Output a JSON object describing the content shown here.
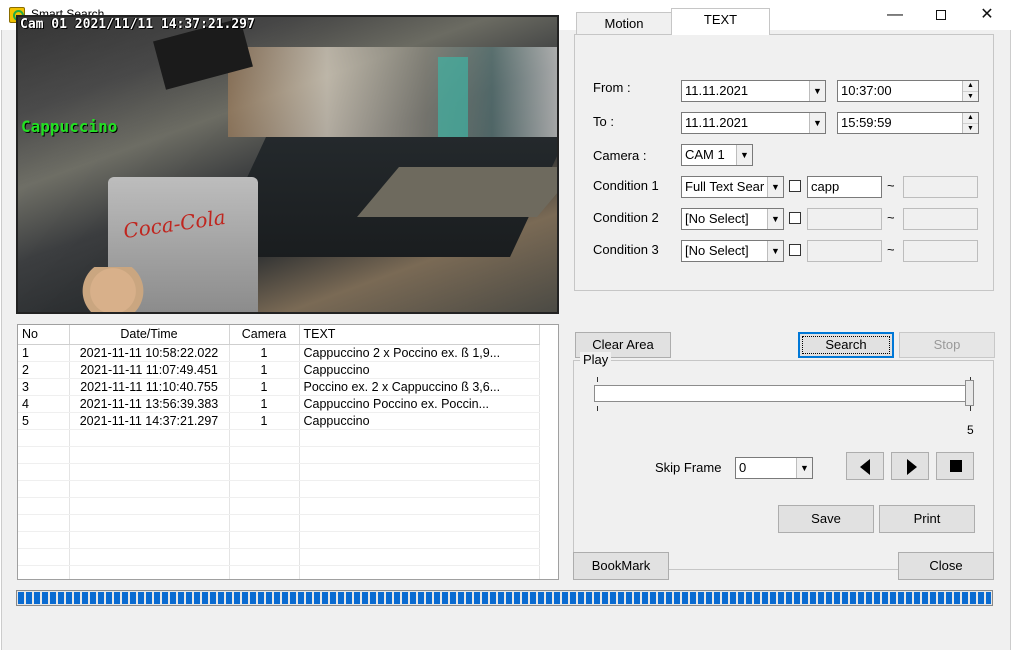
{
  "window": {
    "title": "Smart Search",
    "minimize": "—",
    "close": "✕"
  },
  "video": {
    "timestamp": "Cam 01 2021/11/11 14:37:21.297",
    "overlay_text": "Cappuccino",
    "sign_text": "Coca-Cola"
  },
  "results": {
    "columns": [
      "No",
      "Date/Time",
      "Camera",
      "TEXT"
    ],
    "rows": [
      {
        "no": "1",
        "datetime": "2021-11-11 10:58:22.022",
        "camera": "1",
        "text": "Cappuccino 2 x Poccino ex.  ß 1,9..."
      },
      {
        "no": "2",
        "datetime": "2021-11-11 11:07:49.451",
        "camera": "1",
        "text": "Cappuccino"
      },
      {
        "no": "3",
        "datetime": "2021-11-11 11:10:40.755",
        "camera": "1",
        "text": "Poccino ex. 2 x Cappuccino  ß 3,6..."
      },
      {
        "no": "4",
        "datetime": "2021-11-11 13:56:39.383",
        "camera": "1",
        "text": "Cappuccino Poccino ex. Poccin..."
      },
      {
        "no": "5",
        "datetime": "2021-11-11 14:37:21.297",
        "camera": "1",
        "text": "Cappuccino"
      }
    ]
  },
  "tabs": {
    "motion": "Motion",
    "text": "TEXT",
    "active": "TEXT"
  },
  "form": {
    "from_label": "From :",
    "from_date": "11.11.2021",
    "from_time": "10:37:00",
    "to_label": "To :",
    "to_date": "11.11.2021",
    "to_time": "15:59:59",
    "camera_label": "Camera :",
    "camera_value": "CAM 1",
    "conditions": [
      {
        "label": "Condition 1",
        "type": "Full Text Sear",
        "checked": false,
        "value1": "capp",
        "tilde": "~",
        "value2": ""
      },
      {
        "label": "Condition 2",
        "type": "[No Select]",
        "checked": false,
        "value1": "",
        "tilde": "~",
        "value2": ""
      },
      {
        "label": "Condition 3",
        "type": "[No Select]",
        "checked": false,
        "value1": "",
        "tilde": "~",
        "value2": ""
      }
    ]
  },
  "buttons": {
    "clear_area": "Clear Area",
    "search": "Search",
    "stop": "Stop",
    "save": "Save",
    "print": "Print",
    "bookmark": "BookMark",
    "close": "Close"
  },
  "play": {
    "title": "Play",
    "slider_max": "5",
    "slider_position": 1.0,
    "skip_frame_label": "Skip Frame",
    "skip_frame_value": "0"
  },
  "progress": {
    "fraction": 1.0
  }
}
